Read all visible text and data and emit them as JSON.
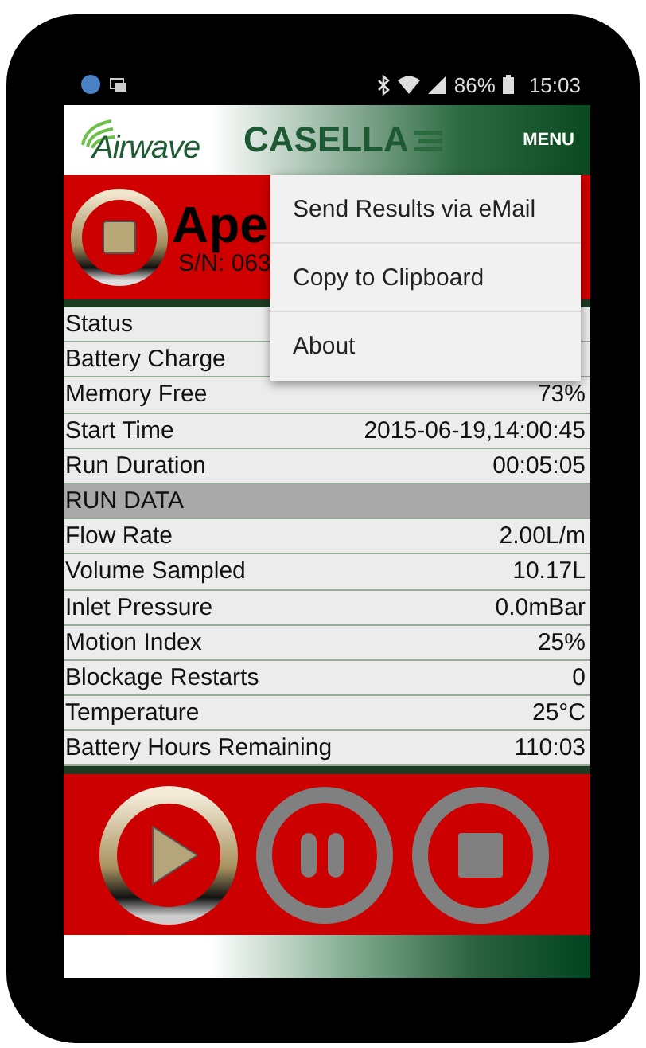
{
  "status_bar": {
    "battery": "86%",
    "time": "15:03"
  },
  "header": {
    "logo": "Airwave",
    "brand": "CASELLA",
    "menu": "MENU"
  },
  "device": {
    "name": "Ape",
    "serial": "S/N: 063"
  },
  "rows": [
    {
      "kind": "row",
      "label": "Status"
    },
    {
      "kind": "row",
      "label": "Battery Charge"
    },
    {
      "kind": "row",
      "label": "Memory Free",
      "value": "73%"
    },
    {
      "kind": "row",
      "label": "Start Time",
      "value": "2015-06-19,14:00:45"
    },
    {
      "kind": "row",
      "label": "Run Duration",
      "value": "00:05:05"
    },
    {
      "kind": "section",
      "label": "RUN DATA"
    },
    {
      "kind": "row",
      "label": "Flow Rate",
      "value": "2.00L/m"
    },
    {
      "kind": "row",
      "label": "Volume Sampled",
      "value": "10.17L"
    },
    {
      "kind": "row",
      "label": "Inlet Pressure",
      "value": "0.0mBar"
    },
    {
      "kind": "row",
      "label": "Motion Index",
      "value": "25%"
    },
    {
      "kind": "row",
      "label": "Blockage Restarts",
      "value": "0"
    },
    {
      "kind": "row",
      "label": "Temperature",
      "value": "25°C"
    },
    {
      "kind": "row",
      "label": "Battery Hours Remaining",
      "value": "110:03"
    }
  ],
  "controls": [
    {
      "kind": "play",
      "enabled": true
    },
    {
      "kind": "pause",
      "enabled": false
    },
    {
      "kind": "stop",
      "enabled": false
    }
  ],
  "menu": {
    "items": [
      "Send Results via eMail",
      "Copy to Clipboard",
      "About"
    ]
  }
}
